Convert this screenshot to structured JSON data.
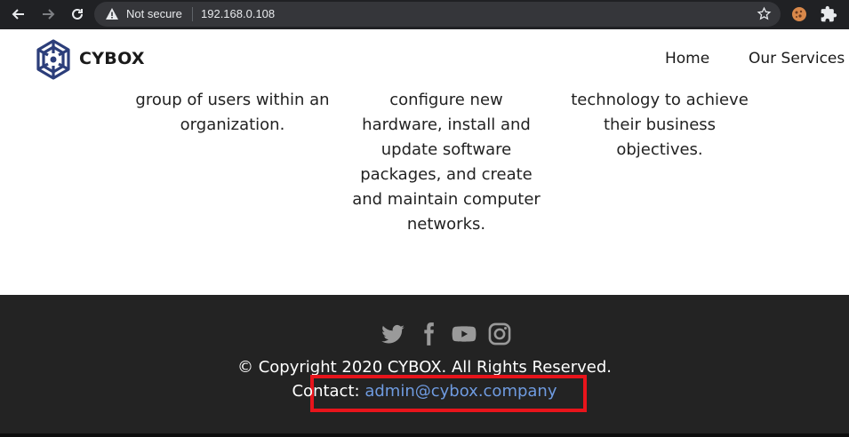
{
  "browser": {
    "security_label": "Not secure",
    "url": "192.168.0.108"
  },
  "header": {
    "brand": "CYBOX",
    "nav": [
      "Home",
      "Our Services"
    ]
  },
  "columns": [
    {
      "lines": [
        "group of users within an",
        "organization."
      ]
    },
    {
      "lines": [
        "configure new",
        "hardware, install and",
        "update software",
        "packages, and create",
        "and maintain computer",
        "networks."
      ]
    },
    {
      "lines": [
        "technology to achieve",
        "their business",
        "objectives."
      ]
    }
  ],
  "footer": {
    "social_icons": [
      "twitter-icon",
      "facebook-icon",
      "youtube-icon",
      "instagram-icon"
    ],
    "copyright": "© Copyright 2020 CYBOX. All Rights Reserved.",
    "contact_label": "Contact:",
    "contact_email": "admin@cybox.company"
  },
  "colors": {
    "footer_bg": "#232323",
    "link": "#6f9be0",
    "highlight": "#e8141b",
    "brand_blue": "#2c3e7a"
  }
}
